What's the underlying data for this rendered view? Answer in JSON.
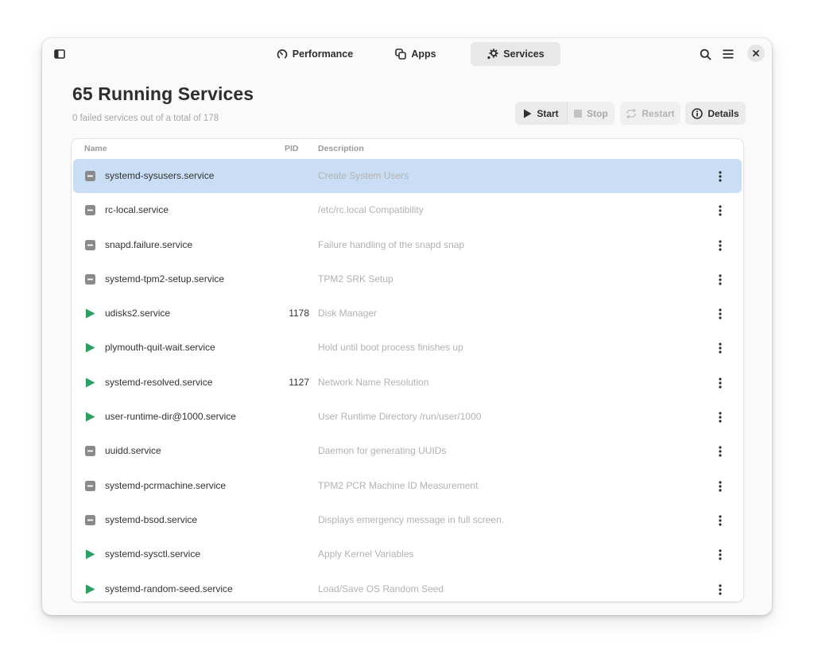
{
  "header": {
    "tabs": [
      {
        "label": "Performance",
        "icon": "gauge-icon",
        "active": false
      },
      {
        "label": "Apps",
        "icon": "apps-icon",
        "active": false
      },
      {
        "label": "Services",
        "icon": "gears-icon",
        "active": true
      }
    ],
    "sidebar_toggle_icon": "sidebar-icon",
    "search_icon": "search-icon",
    "menu_icon": "hamburger-icon",
    "close_icon": "close-icon"
  },
  "page": {
    "title": "65 Running Services",
    "subtitle": "0 failed services out of a total of 178"
  },
  "actions": {
    "start": "Start",
    "stop": "Stop",
    "restart": "Restart",
    "details": "Details"
  },
  "table": {
    "columns": {
      "name": "Name",
      "pid": "PID",
      "description": "Description"
    },
    "rows": [
      {
        "name": "systemd-sysusers.service",
        "pid": "",
        "description": "Create System Users",
        "status": "stopped",
        "selected": true
      },
      {
        "name": "rc-local.service",
        "pid": "",
        "description": "/etc/rc.local Compatibility",
        "status": "stopped",
        "selected": false
      },
      {
        "name": "snapd.failure.service",
        "pid": "",
        "description": "Failure handling of the snapd snap",
        "status": "stopped",
        "selected": false
      },
      {
        "name": "systemd-tpm2-setup.service",
        "pid": "",
        "description": "TPM2 SRK Setup",
        "status": "stopped",
        "selected": false
      },
      {
        "name": "udisks2.service",
        "pid": "1178",
        "description": "Disk Manager",
        "status": "running",
        "selected": false
      },
      {
        "name": "plymouth-quit-wait.service",
        "pid": "",
        "description": "Hold until boot process finishes up",
        "status": "running",
        "selected": false
      },
      {
        "name": "systemd-resolved.service",
        "pid": "1127",
        "description": "Network Name Resolution",
        "status": "running",
        "selected": false
      },
      {
        "name": "user-runtime-dir@1000.service",
        "pid": "",
        "description": "User Runtime Directory /run/user/1000",
        "status": "running",
        "selected": false
      },
      {
        "name": "uuidd.service",
        "pid": "",
        "description": "Daemon for generating UUIDs",
        "status": "stopped",
        "selected": false
      },
      {
        "name": "systemd-pcrmachine.service",
        "pid": "",
        "description": "TPM2 PCR Machine ID Measurement",
        "status": "stopped",
        "selected": false
      },
      {
        "name": "systemd-bsod.service",
        "pid": "",
        "description": "Displays emergency message in full screen.",
        "status": "stopped",
        "selected": false
      },
      {
        "name": "systemd-sysctl.service",
        "pid": "",
        "description": "Apply Kernel Variables",
        "status": "running",
        "selected": false
      },
      {
        "name": "systemd-random-seed.service",
        "pid": "",
        "description": "Load/Save OS Random Seed",
        "status": "running",
        "selected": false
      }
    ]
  },
  "colors": {
    "running": "#2e9e62",
    "stopped": "#8a8a8a",
    "selected_row": "#c9def4"
  }
}
